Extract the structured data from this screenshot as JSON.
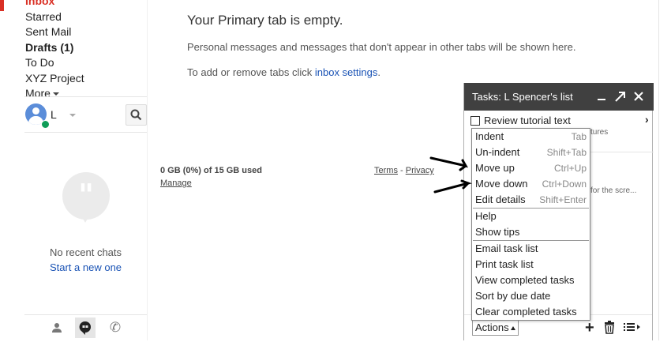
{
  "nav": {
    "items": [
      {
        "label": "Inbox",
        "style": "inbox"
      },
      {
        "label": "Starred",
        "style": "normal"
      },
      {
        "label": "Sent Mail",
        "style": "normal"
      },
      {
        "label": "Drafts (1)",
        "style": "bold"
      },
      {
        "label": "To Do",
        "style": "normal"
      },
      {
        "label": "XYZ Project",
        "style": "normal"
      },
      {
        "label": "More",
        "style": "normal"
      }
    ]
  },
  "user": {
    "initial": "L",
    "status_color": "#0f9d58"
  },
  "chats": {
    "empty_text": "No recent chats",
    "start_link": "Start a new one"
  },
  "main": {
    "title": "Your Primary tab is empty.",
    "description": "Personal messages and messages that don't appear in other tabs will be shown here.",
    "tabs_text": "To add or remove tabs click ",
    "tabs_link": "inbox settings",
    "tabs_period": "."
  },
  "footer": {
    "storage": "0 GB (0%) of 15 GB used",
    "manage": "Manage",
    "terms": "Terms",
    "separator": " - ",
    "privacy": "Privacy"
  },
  "tasks": {
    "title": "Tasks: L Spencer's list",
    "item_text": "Review tutorial text",
    "sub_text_1": "tures",
    "sub_text_2": "for the scre...",
    "actions_label": "Actions"
  },
  "menu": {
    "groups": [
      [
        {
          "label": "Indent",
          "shortcut": "Tab"
        },
        {
          "label": "Un-indent",
          "shortcut": "Shift+Tab"
        },
        {
          "label": "Move up",
          "shortcut": "Ctrl+Up"
        },
        {
          "label": "Move down",
          "shortcut": "Ctrl+Down"
        },
        {
          "label": "Edit details",
          "shortcut": "Shift+Enter"
        }
      ],
      [
        {
          "label": "Help",
          "shortcut": ""
        },
        {
          "label": "Show tips",
          "shortcut": ""
        }
      ],
      [
        {
          "label": "Email task list",
          "shortcut": ""
        },
        {
          "label": "Print task list",
          "shortcut": ""
        },
        {
          "label": "View completed tasks",
          "shortcut": ""
        },
        {
          "label": "Sort by due date",
          "shortcut": ""
        },
        {
          "label": "Clear completed tasks",
          "shortcut": ""
        }
      ]
    ]
  },
  "colors": {
    "accent_red": "#d93025",
    "link_blue": "#1a53b5",
    "tasks_header": "#404040"
  }
}
